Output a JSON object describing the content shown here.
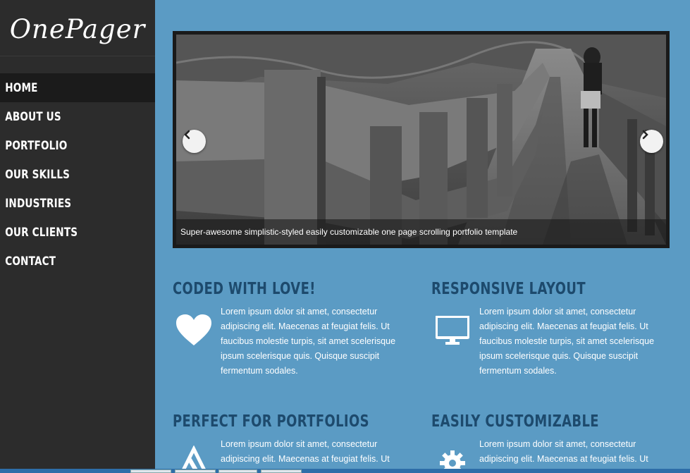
{
  "brand": {
    "logo": "OnePager"
  },
  "nav": {
    "items": [
      {
        "label": "Home",
        "active": true
      },
      {
        "label": "About Us"
      },
      {
        "label": "Portfolio"
      },
      {
        "label": "Our Skills"
      },
      {
        "label": "Industries"
      },
      {
        "label": "Our Clients"
      },
      {
        "label": "Contact"
      }
    ]
  },
  "slider": {
    "caption": "Super-awesome simplistic-styled easily customizable one page scrolling portfolio template",
    "prev_icon": "chevron-left-icon",
    "next_icon": "chevron-right-icon"
  },
  "features": [
    {
      "title": "Coded with love!",
      "icon": "heart-icon",
      "text": "Lorem ipsum dolor sit amet, consectetur adipiscing elit. Maecenas at feugiat felis. Ut faucibus molestie turpis, sit amet scelerisque ipsum scelerisque quis. Quisque suscipit fermentum sodales."
    },
    {
      "title": "Responsive Layout",
      "icon": "monitor-icon",
      "text": "Lorem ipsum dolor sit amet, consectetur adipiscing elit. Maecenas at feugiat felis. Ut faucibus molestie turpis, sit amet scelerisque ipsum scelerisque quis. Quisque suscipit fermentum sodales."
    },
    {
      "title": "Perfect for Portfolios",
      "icon": "tools-icon",
      "text": "Lorem ipsum dolor sit amet, consectetur adipiscing elit. Maecenas at feugiat felis. Ut"
    },
    {
      "title": "Easily Customizable",
      "icon": "gear-icon",
      "text": "Lorem ipsum dolor sit amet, consectetur adipiscing elit. Maecenas at feugiat felis. Ut"
    }
  ],
  "colors": {
    "sidebar": "#2c2c2c",
    "background": "#5b9bc4",
    "heading": "#1d4a6d"
  }
}
